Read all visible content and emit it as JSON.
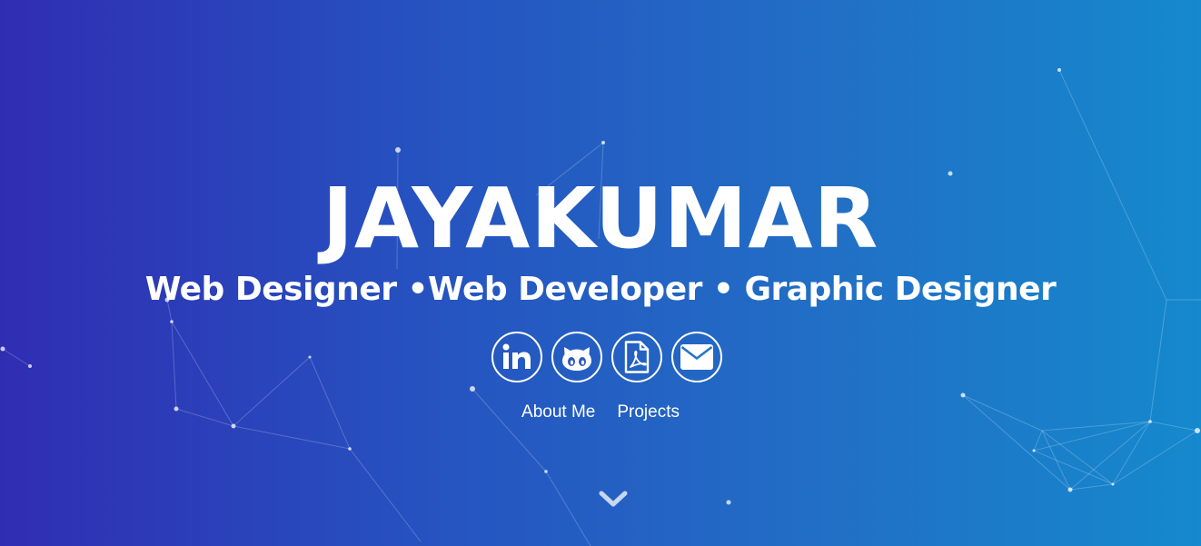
{
  "hero": {
    "name": "JAYAKUMAR",
    "tagline": "Web Designer •Web Developer • Graphic Designer"
  },
  "social": [
    {
      "name": "linkedin-icon",
      "label": "LinkedIn"
    },
    {
      "name": "github-icon",
      "label": "GitHub"
    },
    {
      "name": "pdf-icon",
      "label": "Resume"
    },
    {
      "name": "email-icon",
      "label": "Email"
    }
  ],
  "nav": {
    "about_label": "About Me",
    "projects_label": "Projects"
  },
  "icons": {
    "scroll": "chevron-down-icon"
  },
  "colors": {
    "gradient_start": "#302db3",
    "gradient_end": "#1589cd",
    "text": "#ffffff"
  }
}
